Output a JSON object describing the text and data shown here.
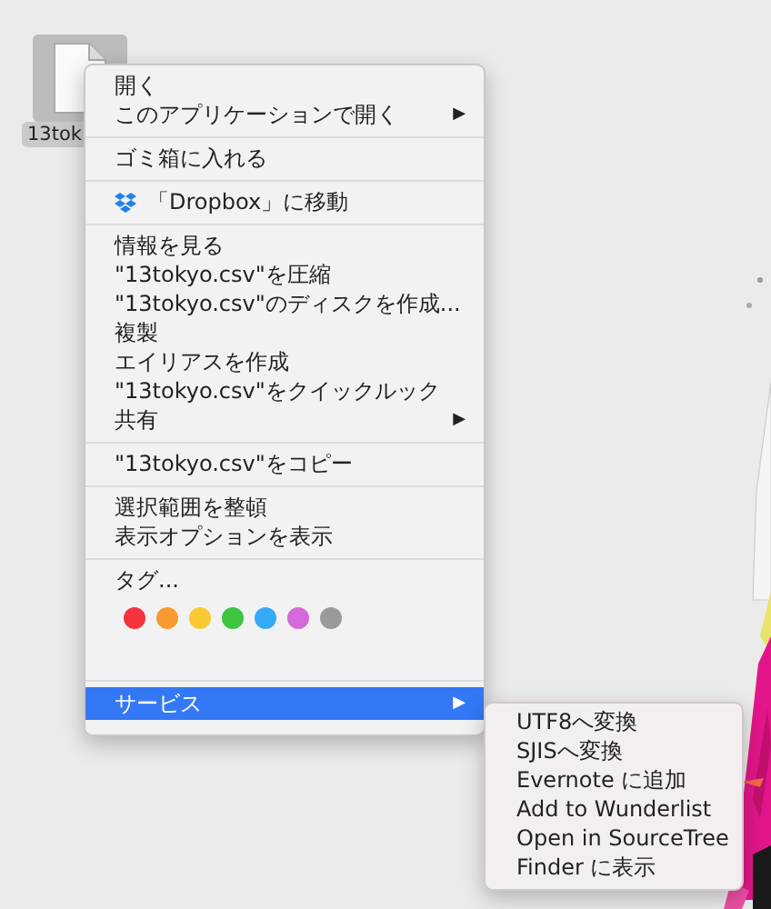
{
  "desktop": {
    "file": {
      "label": "13tok"
    }
  },
  "menu": {
    "groups": [
      {
        "items": [
          {
            "kind": "item",
            "label": "開く",
            "selected": false
          },
          {
            "kind": "item",
            "label": "このアプリケーションで開く",
            "arrow": "▶",
            "selected": false
          }
        ]
      },
      {
        "items": [
          {
            "kind": "item",
            "label": "ゴミ箱に入れる",
            "selected": false
          }
        ]
      },
      {
        "items": [
          {
            "kind": "dropbox",
            "label": "「Dropbox」に移動",
            "selected": false
          }
        ]
      },
      {
        "items": [
          {
            "kind": "item",
            "label": "情報を見る",
            "selected": false
          },
          {
            "kind": "item",
            "label": "\"13tokyo.csv\"を圧縮",
            "selected": false
          },
          {
            "kind": "item",
            "label": "\"13tokyo.csv\"のディスクを作成...",
            "selected": false
          },
          {
            "kind": "item",
            "label": "複製",
            "selected": false
          },
          {
            "kind": "item",
            "label": "エイリアスを作成",
            "selected": false
          },
          {
            "kind": "item",
            "label": "\"13tokyo.csv\"をクイックルック",
            "selected": false
          },
          {
            "kind": "item",
            "label": "共有",
            "arrow": "▶",
            "selected": false
          }
        ]
      },
      {
        "items": [
          {
            "kind": "item",
            "label": "\"13tokyo.csv\"をコピー",
            "selected": false
          }
        ]
      },
      {
        "items": [
          {
            "kind": "item",
            "label": "選択範囲を整頓",
            "selected": false
          },
          {
            "kind": "item",
            "label": "表示オプションを表示",
            "selected": false
          }
        ]
      },
      {
        "items": [
          {
            "kind": "item",
            "label": "タグ...",
            "selected": false
          },
          {
            "kind": "tags",
            "dots": [
              {
                "color": "#f5333f"
              },
              {
                "color": "#f79a31"
              },
              {
                "color": "#f9c833"
              },
              {
                "color": "#3dc53f"
              },
              {
                "color": "#36aaf5"
              },
              {
                "color": "#d46ad9"
              },
              {
                "color": "#9a9a9a"
              }
            ]
          }
        ]
      },
      {
        "items": [
          {
            "kind": "item",
            "label": "サービス",
            "arrow": "▶",
            "selected": true
          }
        ]
      }
    ]
  },
  "submenu": {
    "items": [
      {
        "label": "UTF8へ変換"
      },
      {
        "label": "SJISへ変換"
      },
      {
        "label": "Evernote に追加"
      },
      {
        "label": "Add to Wunderlist"
      },
      {
        "label": "Open in SourceTree"
      },
      {
        "label": "Finder に表示"
      }
    ]
  }
}
